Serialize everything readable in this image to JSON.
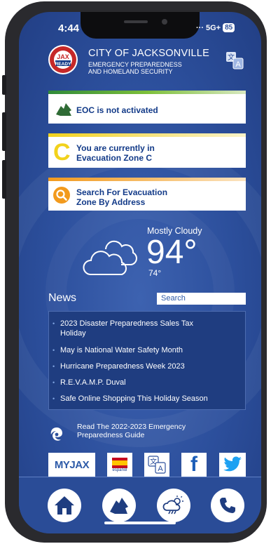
{
  "status_bar": {
    "time": "4:44",
    "network": "5G+",
    "battery": "85"
  },
  "header": {
    "logo_text": [
      "JAX",
      "READY"
    ],
    "title": "CITY OF JACKSONVILLE",
    "subtitle_line1": "EMERGENCY PREPAREDNESS",
    "subtitle_line2": "AND HOMELAND SECURITY",
    "translate_icon": "translate-icon"
  },
  "cards": [
    {
      "text": "EOC is not activated",
      "icon": "florida-eoc-icon",
      "accent": "#2f8a3a"
    },
    {
      "line1": "You are currently in",
      "line2": "Evacuation Zone C",
      "icon_letter": "C",
      "accent": "#f2d21b"
    },
    {
      "line1": "Search For Evacuation",
      "line2": "Zone By Address",
      "icon": "search-icon",
      "accent": "#f29a1d"
    }
  ],
  "weather": {
    "condition": "Mostly Cloudy",
    "temp": "94°",
    "low": "74°",
    "icon": "cloud-icon"
  },
  "news": {
    "title": "News",
    "search_placeholder": "Search",
    "items": [
      {
        "line1": "2023 Disaster Preparedness Sales Tax",
        "line2": "Holiday"
      },
      {
        "line1": "May is National Water Safety Month",
        "line2": ""
      },
      {
        "line1": "Hurricane Preparedness Week 2023",
        "line2": ""
      },
      {
        "line1": "R.E.V.A.M.P. Duval",
        "line2": ""
      },
      {
        "line1": "Safe Online Shopping This Holiday Season",
        "line2": ""
      }
    ]
  },
  "guide": {
    "line1": "Read The 2022-2023 Emergency",
    "line2": "Preparedness Guide",
    "icon": "hurricane-icon"
  },
  "quick_links": [
    {
      "label": "MYJAX",
      "icon": "myjax-logo"
    },
    {
      "label": "español",
      "icon": "spain-flag-icon"
    },
    {
      "label": "",
      "icon": "translate-icon"
    },
    {
      "label": "",
      "icon": "facebook-icon"
    },
    {
      "label": "",
      "icon": "twitter-icon"
    }
  ],
  "tab_bar": [
    {
      "icon": "home-icon"
    },
    {
      "icon": "florida-map-icon"
    },
    {
      "icon": "weather-storm-icon"
    },
    {
      "icon": "phone-icon"
    }
  ],
  "colors": {
    "background": "#2c4f9c",
    "card_text": "#123a88",
    "news_box": "#1f3d80"
  }
}
